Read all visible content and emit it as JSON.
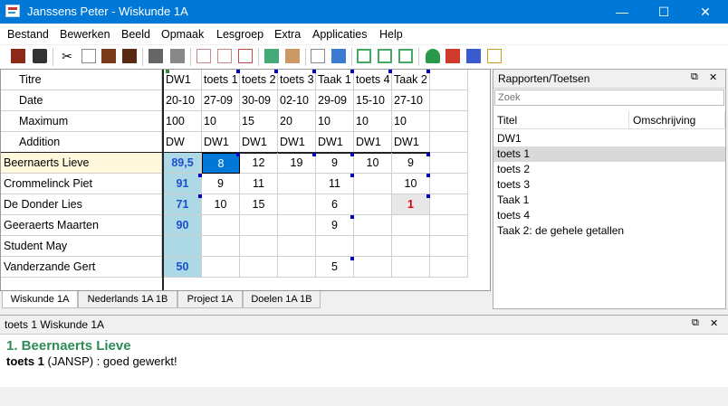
{
  "window": {
    "title": "Janssens Peter - Wiskunde 1A",
    "minimize": "—",
    "maximize": "☐",
    "close": "✕"
  },
  "menu": [
    "Bestand",
    "Bewerken",
    "Beeld",
    "Opmaak",
    "Lesgroep",
    "Extra",
    "Applicaties",
    "Help"
  ],
  "toolbar_icons": [
    "exit-icon",
    "save-icon",
    "cut-icon",
    "copy-icon",
    "paste-icon",
    "paste-special-icon",
    "print-icon",
    "print-preview-icon",
    "new-test-icon",
    "edit-test-icon",
    "delete-test-icon",
    "calculate-icon",
    "tools-icon",
    "report-icon",
    "student-icon",
    "window-left-icon",
    "window-right-icon",
    "window-bottom-icon",
    "person-icon",
    "move-icon",
    "network-icon",
    "notes-icon"
  ],
  "grid": {
    "header_rows": [
      {
        "label": "Titre",
        "values": [
          "DW1",
          "toets 1",
          "toets 2",
          "toets 3",
          "Taak 1",
          "toets 4",
          "Taak 2",
          ""
        ]
      },
      {
        "label": "Date",
        "values": [
          "20-10",
          "27-09",
          "30-09",
          "02-10",
          "29-09",
          "15-10",
          "27-10",
          ""
        ]
      },
      {
        "label": "Maximum",
        "values": [
          "100",
          "10",
          "15",
          "20",
          "10",
          "10",
          "10",
          ""
        ]
      },
      {
        "label": "Addition",
        "values": [
          "DW",
          "DW1",
          "DW1",
          "DW1",
          "DW1",
          "DW1",
          "DW1",
          ""
        ]
      }
    ],
    "students": [
      {
        "name": "Beernaerts Lieve",
        "total": "89,5",
        "scores": [
          "8",
          "12",
          "19",
          "9",
          "10",
          "9",
          ""
        ]
      },
      {
        "name": "Crommelinck Piet",
        "total": "91",
        "scores": [
          "9",
          "11",
          "",
          "11",
          "",
          "10",
          ""
        ]
      },
      {
        "name": "De Donder Lies",
        "total": "71",
        "scores": [
          "10",
          "15",
          "",
          "6",
          "",
          "1",
          ""
        ]
      },
      {
        "name": "Geeraerts Maarten",
        "total": "90",
        "scores": [
          "",
          "",
          "",
          "9",
          "",
          "",
          ""
        ]
      },
      {
        "name": "Student May",
        "total": "",
        "scores": [
          "",
          "",
          "",
          "",
          "",
          "",
          ""
        ]
      },
      {
        "name": "Vanderzande Gert",
        "total": "50",
        "scores": [
          "",
          "",
          "",
          "5",
          "",
          "",
          ""
        ]
      }
    ],
    "colors": {
      "total_bg": "#add8e6",
      "selected_bg": "#0078d7",
      "highlight_row": "#fff8dc",
      "low_score": "#e00000",
      "total_text": "#1a4fd0"
    }
  },
  "tabs": [
    {
      "label": "Wiskunde 1A",
      "active": true
    },
    {
      "label": "Nederlands 1A 1B",
      "active": false
    },
    {
      "label": "Project 1A",
      "active": false
    },
    {
      "label": "Doelen 1A 1B",
      "active": false
    }
  ],
  "reports_panel": {
    "title": "Rapporten/Toetsen",
    "pin": "⧉",
    "close": "✕",
    "search_placeholder": "Zoek",
    "columns": [
      "Titel",
      "Omschrijving"
    ],
    "items": [
      {
        "label": "DW1",
        "selected": false
      },
      {
        "label": "toets 1",
        "selected": true
      },
      {
        "label": "toets 2",
        "selected": false
      },
      {
        "label": "toets 3",
        "selected": false
      },
      {
        "label": "Taak 1",
        "selected": false
      },
      {
        "label": "toets 4",
        "selected": false
      },
      {
        "label": "Taak 2: de gehele getallen",
        "selected": false
      }
    ]
  },
  "detail_panel": {
    "title": "toets 1 Wiskunde 1A",
    "pin": "⧉",
    "close": "✕",
    "name": "1. Beernaerts Lieve",
    "test_bold": "toets 1",
    "comment": " (JANSP) : goed gewerkt!"
  }
}
